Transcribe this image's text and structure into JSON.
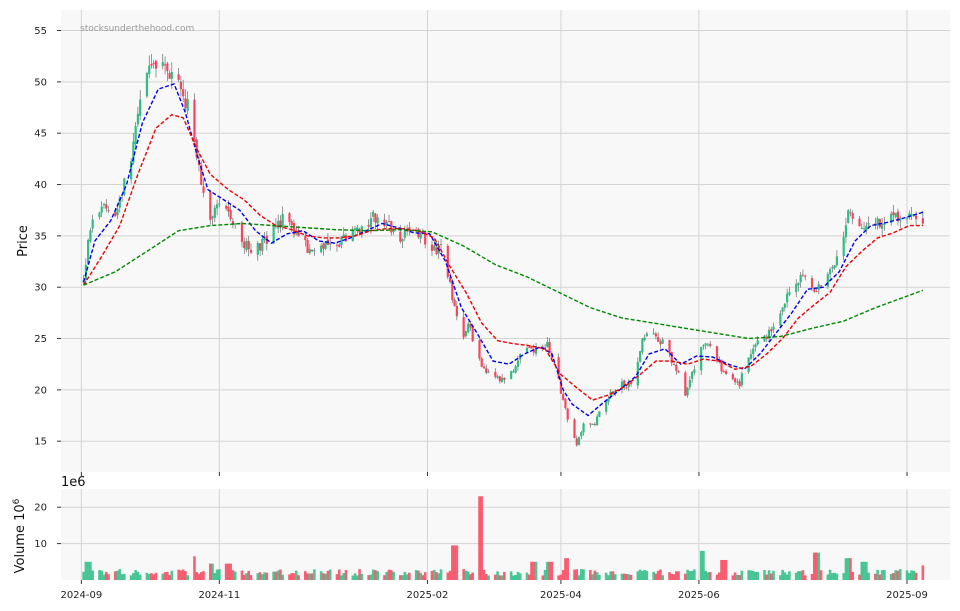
{
  "chart_data": {
    "type": "candlestick",
    "watermark": "stocksunderthehood.com",
    "ylabel": "Price",
    "ylim": [
      12,
      57
    ],
    "yticks": [
      15,
      20,
      25,
      30,
      35,
      40,
      45,
      50,
      55
    ],
    "xlim": [
      "2024-08-23",
      "2025-09-20"
    ],
    "xticks": [
      {
        "date": "2024-09-01",
        "label": "2024-09"
      },
      {
        "date": "2024-11-01",
        "label": "2024-11"
      },
      {
        "date": "2025-02-01",
        "label": "2025-02"
      },
      {
        "date": "2025-04-01",
        "label": "2025-04"
      },
      {
        "date": "2025-06-01",
        "label": "2025-06"
      },
      {
        "date": "2025-09-01",
        "label": "2025-09"
      }
    ],
    "colors": {
      "up": "#2ebd85",
      "down": "#f6465d",
      "wick": "#555555",
      "background": "#f8f8f8"
    },
    "grid": true,
    "price_path": [
      [
        "2024-09-02",
        30.5
      ],
      [
        "2024-09-04",
        35
      ],
      [
        "2024-09-07",
        37.5
      ],
      [
        "2024-09-12",
        38
      ],
      [
        "2024-09-16",
        37
      ],
      [
        "2024-09-20",
        40
      ],
      [
        "2024-09-24",
        44
      ],
      [
        "2024-09-27",
        49
      ],
      [
        "2024-10-01",
        51
      ],
      [
        "2024-10-05",
        52.5
      ],
      [
        "2024-10-09",
        50.5
      ],
      [
        "2024-10-12",
        51
      ],
      [
        "2024-10-16",
        49
      ],
      [
        "2024-10-20",
        46
      ],
      [
        "2024-10-24",
        40
      ],
      [
        "2024-10-28",
        37
      ],
      [
        "2024-11-01",
        38.5
      ],
      [
        "2024-11-05",
        37
      ],
      [
        "2024-11-09",
        35.5
      ],
      [
        "2024-11-13",
        34
      ],
      [
        "2024-11-17",
        33.5
      ],
      [
        "2024-11-21",
        34.5
      ],
      [
        "2024-11-25",
        35.5
      ],
      [
        "2024-11-29",
        36.5
      ],
      [
        "2024-12-03",
        36
      ],
      [
        "2024-12-07",
        34.5
      ],
      [
        "2024-12-11",
        33.5
      ],
      [
        "2024-12-15",
        34
      ],
      [
        "2024-12-19",
        34.5
      ],
      [
        "2024-12-24",
        34.5
      ],
      [
        "2024-12-29",
        35
      ],
      [
        "2025-01-02",
        35.5
      ],
      [
        "2025-01-06",
        36.5
      ],
      [
        "2025-01-10",
        37
      ],
      [
        "2025-01-15",
        36
      ],
      [
        "2025-01-20",
        35
      ],
      [
        "2025-01-25",
        35.5
      ],
      [
        "2025-01-30",
        35
      ],
      [
        "2025-02-03",
        33.5
      ],
      [
        "2025-02-07",
        34
      ],
      [
        "2025-02-10",
        31
      ],
      [
        "2025-02-13",
        28
      ],
      [
        "2025-02-16",
        25
      ],
      [
        "2025-02-19",
        26.5
      ],
      [
        "2025-02-22",
        24
      ],
      [
        "2025-02-25",
        22
      ],
      [
        "2025-03-01",
        21.5
      ],
      [
        "2025-03-05",
        21
      ],
      [
        "2025-03-10",
        21.5
      ],
      [
        "2025-03-14",
        23.5
      ],
      [
        "2025-03-18",
        24
      ],
      [
        "2025-03-22",
        24
      ],
      [
        "2025-03-26",
        24.5
      ],
      [
        "2025-03-29",
        22.5
      ],
      [
        "2025-04-02",
        19
      ],
      [
        "2025-04-05",
        16.5
      ],
      [
        "2025-04-08",
        14.8
      ],
      [
        "2025-04-11",
        16.5
      ],
      [
        "2025-04-15",
        16.5
      ],
      [
        "2025-04-19",
        18
      ],
      [
        "2025-04-23",
        19.5
      ],
      [
        "2025-04-27",
        20.5
      ],
      [
        "2025-05-01",
        20.5
      ],
      [
        "2025-05-04",
        21.5
      ],
      [
        "2025-05-07",
        25
      ],
      [
        "2025-05-10",
        26
      ],
      [
        "2025-05-14",
        25
      ],
      [
        "2025-05-18",
        24
      ],
      [
        "2025-05-22",
        22
      ],
      [
        "2025-05-26",
        19.5
      ],
      [
        "2025-05-30",
        22
      ],
      [
        "2025-06-03",
        24.5
      ],
      [
        "2025-06-07",
        24
      ],
      [
        "2025-06-11",
        22
      ],
      [
        "2025-06-15",
        21
      ],
      [
        "2025-06-19",
        20.5
      ],
      [
        "2025-06-23",
        23.5
      ],
      [
        "2025-06-27",
        25
      ],
      [
        "2025-07-01",
        25
      ],
      [
        "2025-07-05",
        27
      ],
      [
        "2025-07-09",
        28.5
      ],
      [
        "2025-07-13",
        30
      ],
      [
        "2025-07-17",
        31.5
      ],
      [
        "2025-07-21",
        30
      ],
      [
        "2025-07-25",
        30
      ],
      [
        "2025-07-29",
        32
      ],
      [
        "2025-08-02",
        33
      ],
      [
        "2025-08-06",
        37.5
      ],
      [
        "2025-08-10",
        36.5
      ],
      [
        "2025-08-14",
        35.5
      ],
      [
        "2025-08-18",
        36
      ],
      [
        "2025-08-22",
        36.5
      ],
      [
        "2025-08-26",
        37
      ],
      [
        "2025-08-30",
        37
      ],
      [
        "2025-09-03",
        37.5
      ],
      [
        "2025-09-05",
        37
      ],
      [
        "2025-09-08",
        36
      ]
    ],
    "moving_averages": [
      {
        "color": "#0000ee",
        "points": [
          [
            "2024-09-02",
            30.5
          ],
          [
            "2024-09-07",
            34.5
          ],
          [
            "2024-09-14",
            36.5
          ],
          [
            "2024-09-21",
            40
          ],
          [
            "2024-09-28",
            46
          ],
          [
            "2024-10-05",
            49.3
          ],
          [
            "2024-10-12",
            49.8
          ],
          [
            "2024-10-17",
            47
          ],
          [
            "2024-10-22",
            43
          ],
          [
            "2024-10-27",
            39.5
          ],
          [
            "2024-11-03",
            38.5
          ],
          [
            "2024-11-10",
            37.5
          ],
          [
            "2024-11-17",
            35.5
          ],
          [
            "2024-11-24",
            34.3
          ],
          [
            "2024-12-01",
            35.2
          ],
          [
            "2024-12-08",
            35.5
          ],
          [
            "2024-12-15",
            34.5
          ],
          [
            "2024-12-22",
            34.3
          ],
          [
            "2024-12-29",
            34.8
          ],
          [
            "2025-01-05",
            35.5
          ],
          [
            "2025-01-12",
            36.2
          ],
          [
            "2025-01-19",
            35.8
          ],
          [
            "2025-01-26",
            35.3
          ],
          [
            "2025-02-02",
            35.2
          ],
          [
            "2025-02-09",
            32.5
          ],
          [
            "2025-02-16",
            28
          ],
          [
            "2025-02-23",
            25.5
          ],
          [
            "2025-03-02",
            22.8
          ],
          [
            "2025-03-09",
            22.5
          ],
          [
            "2025-03-16",
            23.5
          ],
          [
            "2025-03-23",
            24.2
          ],
          [
            "2025-03-28",
            23.5
          ],
          [
            "2025-04-02",
            20
          ],
          [
            "2025-04-06",
            18.6
          ],
          [
            "2025-04-13",
            17.5
          ],
          [
            "2025-04-20",
            18.8
          ],
          [
            "2025-04-27",
            20
          ],
          [
            "2025-05-04",
            21.3
          ],
          [
            "2025-05-10",
            23.5
          ],
          [
            "2025-05-17",
            24
          ],
          [
            "2025-05-24",
            22.5
          ],
          [
            "2025-05-31",
            23.3
          ],
          [
            "2025-06-07",
            23.2
          ],
          [
            "2025-06-14",
            22.5
          ],
          [
            "2025-06-21",
            22
          ],
          [
            "2025-06-28",
            23.5
          ],
          [
            "2025-07-05",
            25.5
          ],
          [
            "2025-07-12",
            27.5
          ],
          [
            "2025-07-19",
            29.8
          ],
          [
            "2025-07-26",
            30
          ],
          [
            "2025-08-02",
            31.5
          ],
          [
            "2025-08-09",
            34.5
          ],
          [
            "2025-08-16",
            36
          ],
          [
            "2025-08-23",
            36.3
          ],
          [
            "2025-08-30",
            36.7
          ],
          [
            "2025-09-08",
            37.3
          ]
        ]
      },
      {
        "color": "#ee0000",
        "points": [
          [
            "2024-09-02",
            30.2
          ],
          [
            "2024-09-10",
            33
          ],
          [
            "2024-09-18",
            36
          ],
          [
            "2024-09-26",
            41
          ],
          [
            "2024-10-04",
            45.5
          ],
          [
            "2024-10-11",
            46.8
          ],
          [
            "2024-10-16",
            46.5
          ],
          [
            "2024-10-22",
            43.5
          ],
          [
            "2024-10-28",
            41
          ],
          [
            "2024-11-05",
            39.5
          ],
          [
            "2024-11-12",
            38.5
          ],
          [
            "2024-11-19",
            37
          ],
          [
            "2024-11-26",
            36
          ],
          [
            "2024-12-03",
            35.6
          ],
          [
            "2024-12-10",
            35
          ],
          [
            "2024-12-17",
            34.8
          ],
          [
            "2024-12-24",
            34.8
          ],
          [
            "2024-12-31",
            35
          ],
          [
            "2025-01-07",
            35.5
          ],
          [
            "2025-01-14",
            35.7
          ],
          [
            "2025-01-21",
            35.7
          ],
          [
            "2025-01-28",
            35.5
          ],
          [
            "2025-02-04",
            34.8
          ],
          [
            "2025-02-11",
            32
          ],
          [
            "2025-02-18",
            29.5
          ],
          [
            "2025-02-25",
            26.5
          ],
          [
            "2025-03-04",
            24.8
          ],
          [
            "2025-03-11",
            24.5
          ],
          [
            "2025-03-18",
            24.3
          ],
          [
            "2025-03-25",
            24
          ],
          [
            "2025-04-01",
            21.5
          ],
          [
            "2025-04-08",
            20.2
          ],
          [
            "2025-04-15",
            19
          ],
          [
            "2025-04-22",
            19.5
          ],
          [
            "2025-04-29",
            20.3
          ],
          [
            "2025-05-06",
            21.5
          ],
          [
            "2025-05-13",
            22.8
          ],
          [
            "2025-05-20",
            22.8
          ],
          [
            "2025-05-27",
            22.5
          ],
          [
            "2025-06-03",
            23
          ],
          [
            "2025-06-10",
            22.8
          ],
          [
            "2025-06-17",
            22
          ],
          [
            "2025-06-24",
            22.3
          ],
          [
            "2025-07-01",
            23.5
          ],
          [
            "2025-07-08",
            25
          ],
          [
            "2025-07-15",
            27
          ],
          [
            "2025-07-22",
            28.3
          ],
          [
            "2025-07-29",
            29.5
          ],
          [
            "2025-08-05",
            32
          ],
          [
            "2025-08-12",
            33.5
          ],
          [
            "2025-08-19",
            34.8
          ],
          [
            "2025-08-26",
            35.3
          ],
          [
            "2025-09-02",
            36
          ],
          [
            "2025-09-08",
            36
          ]
        ]
      },
      {
        "color": "#008800",
        "points": [
          [
            "2024-09-02",
            30.2
          ],
          [
            "2024-09-16",
            31.5
          ],
          [
            "2024-09-30",
            33.5
          ],
          [
            "2024-10-14",
            35.5
          ],
          [
            "2024-10-28",
            36
          ],
          [
            "2024-11-11",
            36.2
          ],
          [
            "2024-11-25",
            36
          ],
          [
            "2024-12-09",
            35.8
          ],
          [
            "2024-12-23",
            35.6
          ],
          [
            "2025-01-06",
            35.5
          ],
          [
            "2025-01-20",
            35.6
          ],
          [
            "2025-02-03",
            35.4
          ],
          [
            "2025-02-17",
            34
          ],
          [
            "2025-03-03",
            32.2
          ],
          [
            "2025-03-17",
            31
          ],
          [
            "2025-03-31",
            29.5
          ],
          [
            "2025-04-14",
            28
          ],
          [
            "2025-04-28",
            27
          ],
          [
            "2025-05-12",
            26.5
          ],
          [
            "2025-05-26",
            26
          ],
          [
            "2025-06-09",
            25.5
          ],
          [
            "2025-06-23",
            25
          ],
          [
            "2025-07-07",
            25.2
          ],
          [
            "2025-07-21",
            26
          ],
          [
            "2025-08-04",
            26.7
          ],
          [
            "2025-08-18",
            28
          ],
          [
            "2025-09-08",
            29.7
          ]
        ]
      }
    ],
    "volume": {
      "ylabel": "Volume  10",
      "ylabel_exp": "6",
      "offset_label": "1e6",
      "ylim": [
        0,
        25
      ],
      "yticks": [
        10,
        20
      ],
      "spike_points": [
        [
          "2024-09-04",
          5
        ],
        [
          "2024-10-20",
          6.5
        ],
        [
          "2024-10-28",
          4.5
        ],
        [
          "2024-11-05",
          4.5
        ],
        [
          "2025-02-13",
          9.5
        ],
        [
          "2025-02-15",
          6.5
        ],
        [
          "2025-02-24",
          23
        ],
        [
          "2025-03-20",
          5
        ],
        [
          "2025-03-27",
          5
        ],
        [
          "2025-04-04",
          6
        ],
        [
          "2025-06-02",
          8
        ],
        [
          "2025-06-12",
          5.5
        ],
        [
          "2025-07-23",
          7.5
        ],
        [
          "2025-08-06",
          6
        ],
        [
          "2025-08-13",
          5
        ],
        [
          "2025-09-08",
          4
        ]
      ]
    }
  }
}
